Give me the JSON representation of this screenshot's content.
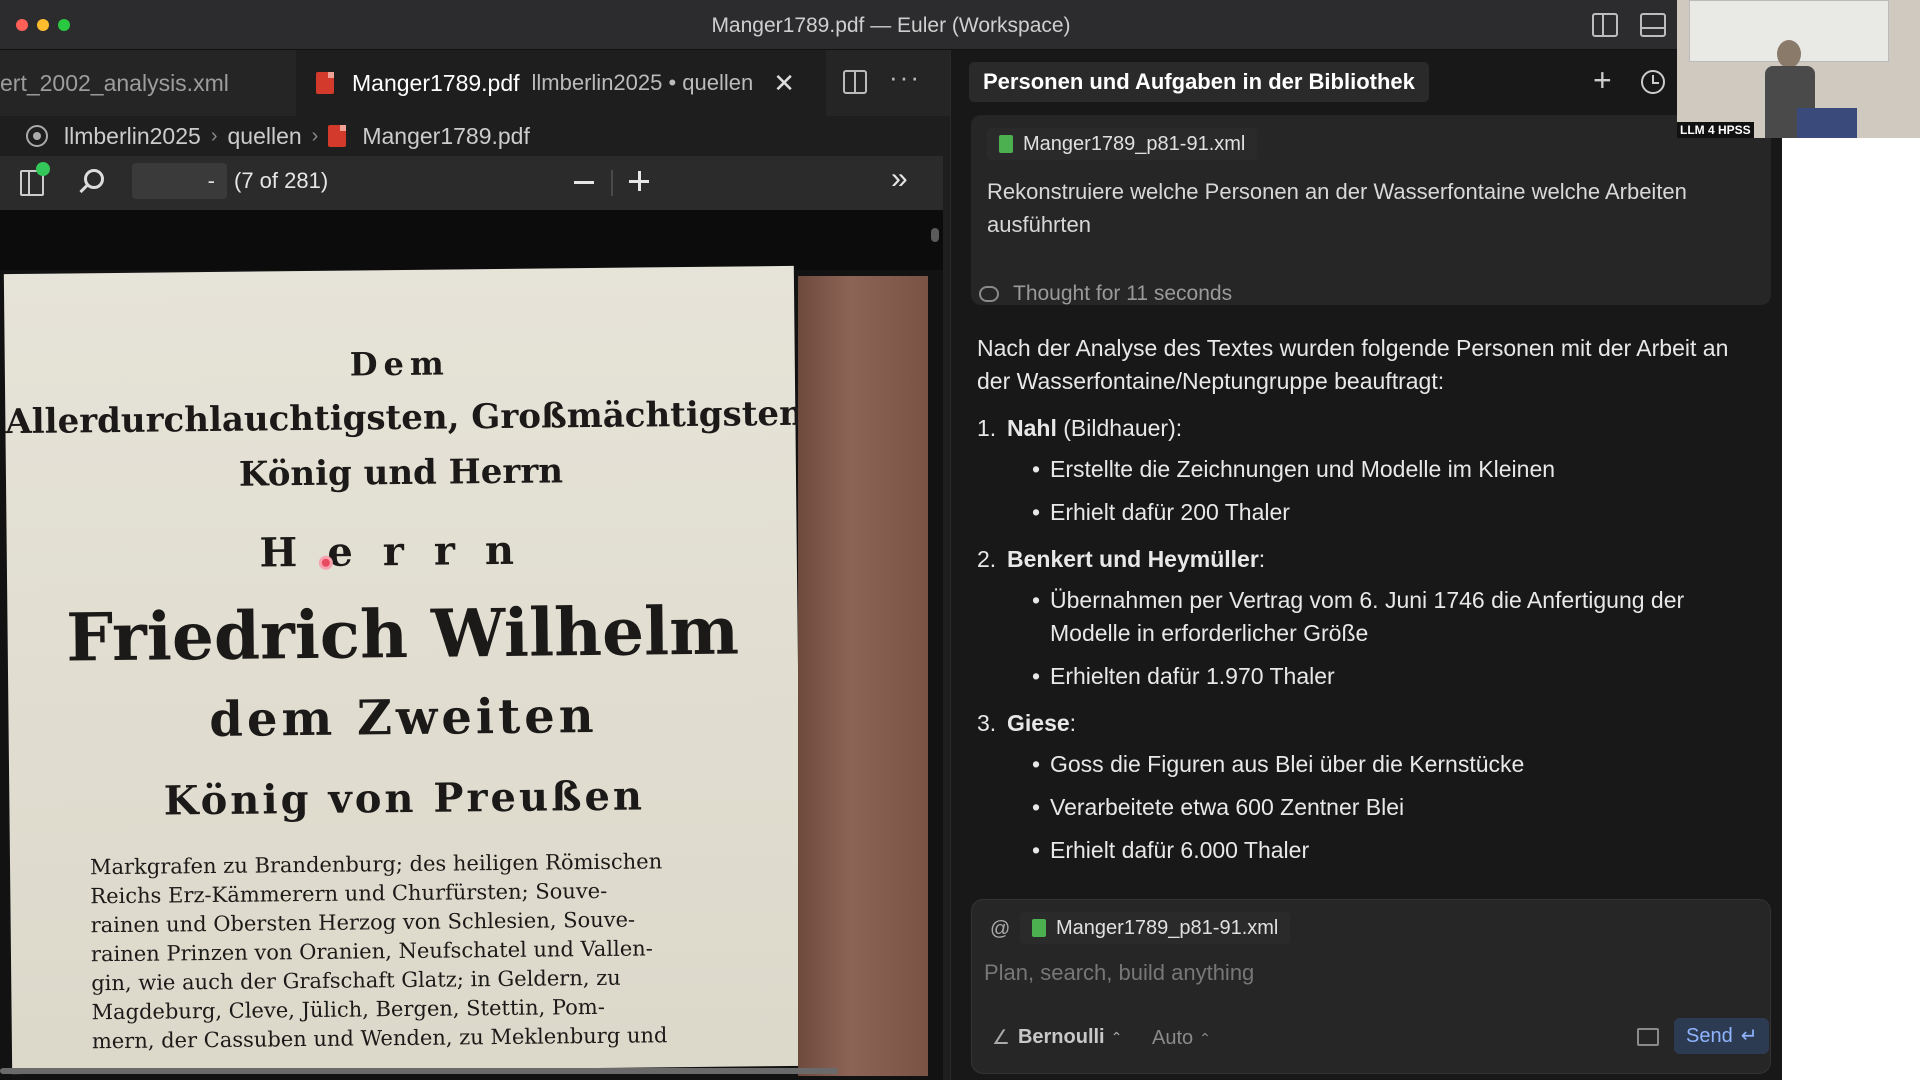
{
  "window": {
    "title": "Manger1789.pdf — Euler (Workspace)"
  },
  "tabs": {
    "inactive_label": "ert_2002_analysis.xml",
    "active_label": "Manger1789.pdf",
    "active_secondary": "llmberlin2025 • quellen"
  },
  "breadcrumb": {
    "items": [
      "llmberlin2025",
      "quellen",
      "Manger1789.pdf"
    ]
  },
  "pdf_toolbar": {
    "page_input_value": "-",
    "page_count": "(7 of 281)"
  },
  "pdf_page": {
    "line1": "Dem",
    "line2": "Allerdurchlauchtigsten, Großmächtigsten",
    "line3": "König und Herrn",
    "line4": "Herrn",
    "line5": "Friedrich Wilhelm",
    "line6": "dem Zweiten",
    "line7": "König von Preußen",
    "paragraph": [
      "Markgrafen zu Brandenburg; des heiligen Römischen",
      "Reichs Erz-Kämmerern und Churfürsten; Souve-",
      "rainen und Obersten Herzog von Schlesien, Souve-",
      "rainen Prinzen von Oranien, Neufschatel und Vallen-",
      "gin, wie auch der Grafschaft Glatz; in Geldern, zu",
      "Magdeburg, Cleve, Jülich, Bergen, Stettin, Pom-",
      "mern, der Cassuben und Wenden, zu Meklenburg und"
    ]
  },
  "chat": {
    "header_title": "Personen und Aufgaben in der Bibliothek",
    "user_message": {
      "attachment": "Manger1789_p81-91.xml",
      "text": "Rekonstruiere welche Personen an der  Wasserfontaine welche Arbeiten ausführten"
    },
    "thought": "Thought for 11 seconds",
    "answer_intro": "Nach der Analyse des Textes wurden folgende Personen mit der Arbeit an der Wasserfontaine/Neptungruppe beauftragt:",
    "items": [
      {
        "number": "1.",
        "name": "Nahl",
        "suffix": " (Bildhauer):",
        "bullets": [
          "Erstellte die Zeichnungen und Modelle im Kleinen",
          "Erhielt dafür 200 Thaler"
        ]
      },
      {
        "number": "2.",
        "name": "Benkert und Heymüller",
        "suffix": ":",
        "bullets": [
          "Übernahmen per Vertrag vom 6. Juni 1746 die Anfertigung der Modelle in erforderlicher Größe",
          "Erhielten dafür 1.970 Thaler"
        ]
      },
      {
        "number": "3.",
        "name": "Giese",
        "suffix": ":",
        "bullets": [
          "Goss die Figuren aus Blei über die Kernstücke",
          "Verarbeitete etwa 600 Zentner Blei",
          "Erhielt dafür 6.000 Thaler"
        ]
      }
    ],
    "composer": {
      "at_symbol": "@",
      "attachment": "Manger1789_p81-91.xml",
      "placeholder": "Plan, search, build anything",
      "model": "Bernoulli",
      "mode": "Auto",
      "send_label": "Send"
    }
  },
  "video_overlay": {
    "label": "LLM 4 HPSS"
  }
}
